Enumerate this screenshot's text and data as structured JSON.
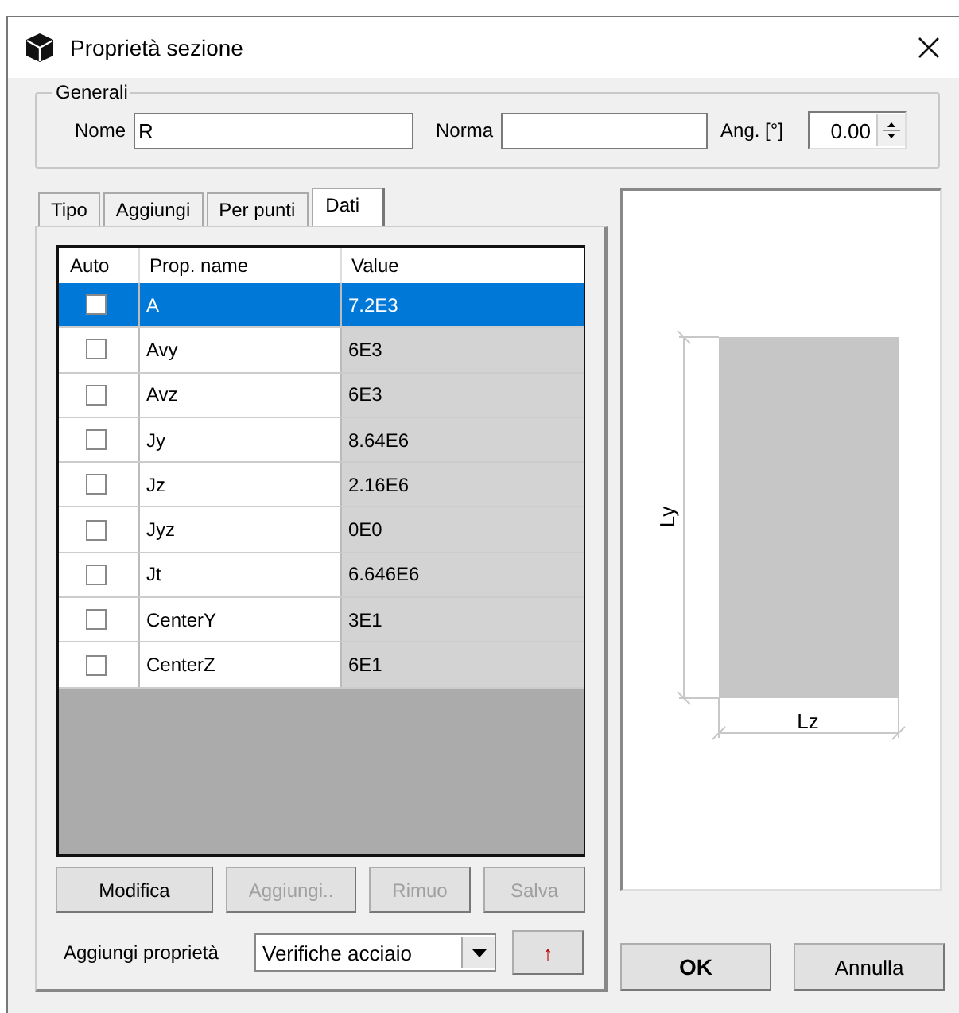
{
  "window": {
    "title": "Proprietà sezione"
  },
  "generali": {
    "title": "Generali",
    "fields": [
      {
        "label": "Nome",
        "value": "R",
        "kind": "text"
      },
      {
        "label": "Norma",
        "kind": "text"
      },
      {
        "label": "Ang. [°]",
        "value": "0.00",
        "kind": "spinner"
      }
    ]
  },
  "tabs": [
    {
      "label": "Tipo",
      "selected": false
    },
    {
      "label": "Aggiungi",
      "selected": false
    },
    {
      "label": "Per punti",
      "selected": false
    },
    {
      "label": "Dati",
      "selected": true
    }
  ],
  "table": {
    "columns": [
      "Auto",
      "Prop. name",
      "Value"
    ],
    "rows": [
      {
        "auto": false,
        "name": "A",
        "value": "7.2E3",
        "selected": true
      },
      {
        "auto": false,
        "name": "Avy",
        "value": "6E3",
        "selected": false
      },
      {
        "auto": false,
        "name": "Avz",
        "value": "6E3",
        "selected": false
      },
      {
        "auto": false,
        "name": "Jy",
        "value": "8.64E6",
        "selected": false
      },
      {
        "auto": false,
        "name": "Jz",
        "value": "2.16E6",
        "selected": false
      },
      {
        "auto": false,
        "name": "Jyz",
        "value": "0E0",
        "selected": false
      },
      {
        "auto": false,
        "name": "Jt",
        "value": "6.646E6",
        "selected": false
      },
      {
        "auto": false,
        "name": "CenterY",
        "value": "3E1",
        "selected": false
      },
      {
        "auto": false,
        "name": "CenterZ",
        "value": "6E1",
        "selected": false
      }
    ]
  },
  "table_buttons": [
    {
      "label": "Modifica",
      "disabled": false
    },
    {
      "label": "Aggiungi..",
      "disabled": true
    },
    {
      "label": "Rimuo",
      "disabled": true
    },
    {
      "label": "Salva",
      "disabled": true
    }
  ],
  "add_property": {
    "label": "Aggiungi proprietà",
    "value": "Verifiche acciaio",
    "button": "↑"
  },
  "preview": {
    "labels": [
      "Ly",
      "Lz"
    ]
  },
  "buttons": [
    {
      "label": "OK",
      "default": true
    },
    {
      "label": "Annulla",
      "default": false
    }
  ]
}
